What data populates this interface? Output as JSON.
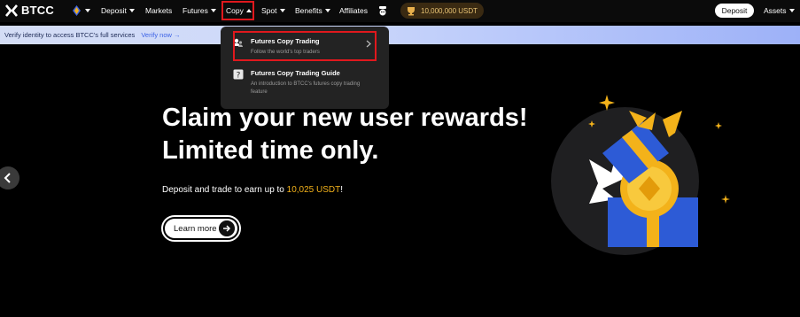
{
  "nav": {
    "logo_text": "BTCC",
    "items": [
      {
        "label": "Deposit",
        "caret": true
      },
      {
        "label": "Markets",
        "caret": false
      },
      {
        "label": "Futures",
        "caret": true
      },
      {
        "label": "Copy",
        "caret": true
      },
      {
        "label": "Spot",
        "caret": true
      },
      {
        "label": "Benefits",
        "caret": true
      },
      {
        "label": "Affiliates",
        "caret": false
      }
    ],
    "balance": "10,000,000 USDT",
    "deposit_button": "Deposit",
    "assets_label": "Assets"
  },
  "banner": {
    "text": "Verify identity to access BTCC's full services",
    "link": "Verify now →"
  },
  "copy_menu": {
    "items": [
      {
        "title": "Futures Copy Trading",
        "subtitle": "Follow the world's top traders",
        "icon": "copy-traders-icon"
      },
      {
        "title": "Futures Copy Trading Guide",
        "subtitle": "An introduction to BTCC's futures copy trading feature",
        "icon": "guide-question-icon"
      }
    ]
  },
  "hero": {
    "title_line1": "Claim your new user rewards!",
    "title_line2": "Limited time only.",
    "subtitle_before": "Deposit and trade to earn up to ",
    "subtitle_amount": "10,025 USDT",
    "subtitle_after": "!",
    "cta": "Learn more"
  },
  "colors": {
    "accent_gold": "#f3b21a",
    "highlight_red": "#e0181d",
    "brand_blue": "#2d5bd6"
  }
}
